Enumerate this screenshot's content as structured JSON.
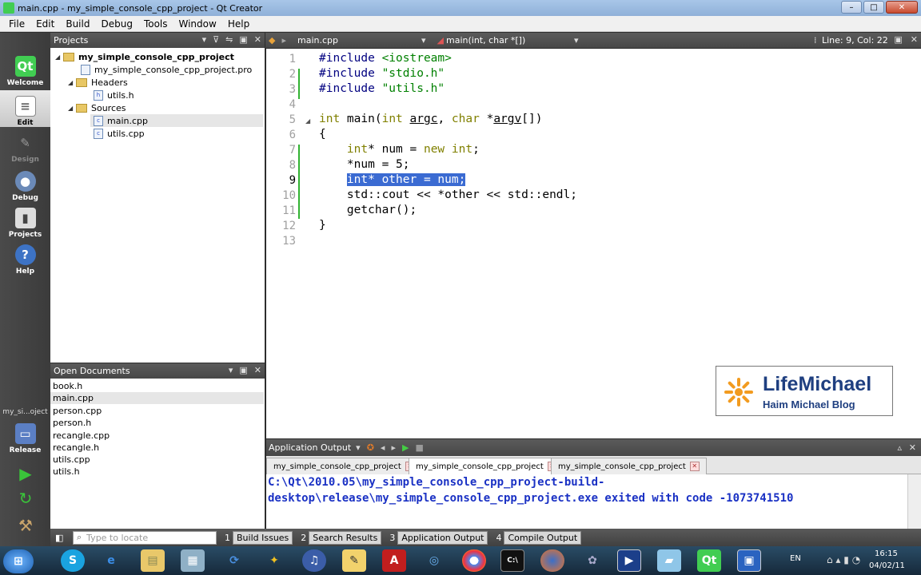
{
  "window": {
    "title": "main.cpp - my_simple_console_cpp_project - Qt Creator"
  },
  "menu": [
    "File",
    "Edit",
    "Build",
    "Debug",
    "Tools",
    "Window",
    "Help"
  ],
  "modes": [
    "Welcome",
    "Edit",
    "Design",
    "Debug",
    "Projects",
    "Help"
  ],
  "mode_icons": {
    "Welcome": "qt-logo-icon",
    "Edit": "document-icon",
    "Design": "pen-icon",
    "Debug": "bug-icon",
    "Projects": "projects-icon",
    "Help": "help-icon"
  },
  "target": {
    "project": "my_si...oject",
    "config": "Release"
  },
  "projects": {
    "header": "Projects",
    "root": "my_simple_console_cpp_project",
    "pro_file": "my_simple_console_cpp_project.pro",
    "headers_label": "Headers",
    "headers": [
      "utils.h"
    ],
    "sources_label": "Sources",
    "sources": [
      "main.cpp",
      "utils.cpp"
    ]
  },
  "open_documents": {
    "header": "Open Documents",
    "items": [
      "book.h",
      "main.cpp",
      "person.cpp",
      "person.h",
      "recangle.cpp",
      "recangle.h",
      "utils.cpp",
      "utils.h"
    ]
  },
  "editor": {
    "file": "main.cpp",
    "function": "main(int, char *[])",
    "position": "Line: 9, Col: 22",
    "line_numbers": [
      "1",
      "2",
      "3",
      "4",
      "5",
      "6",
      "7",
      "8",
      "9",
      "10",
      "11",
      "12",
      "13"
    ]
  },
  "output": {
    "header": "Application Output",
    "tabs": [
      "my_simple_console_cpp_project",
      "my_simple_console_cpp_project",
      "my_simple_console_cpp_project"
    ],
    "text": "C:\\Qt\\2010.05\\my_simple_console_cpp_project-build-\ndesktop\\release\\my_simple_console_cpp_project.exe exited with code -1073741510"
  },
  "statusbar": {
    "locate_placeholder": "Type to locate",
    "panes": [
      {
        "n": "1",
        "label": "Build Issues"
      },
      {
        "n": "2",
        "label": "Search Results"
      },
      {
        "n": "3",
        "label": "Application Output"
      },
      {
        "n": "4",
        "label": "Compile Output"
      }
    ]
  },
  "logo": {
    "name": "LifeMichael",
    "sub": "Haim Michael Blog"
  },
  "taskbar": {
    "lang": "EN",
    "time": "16:15",
    "date": "04/02/11"
  }
}
